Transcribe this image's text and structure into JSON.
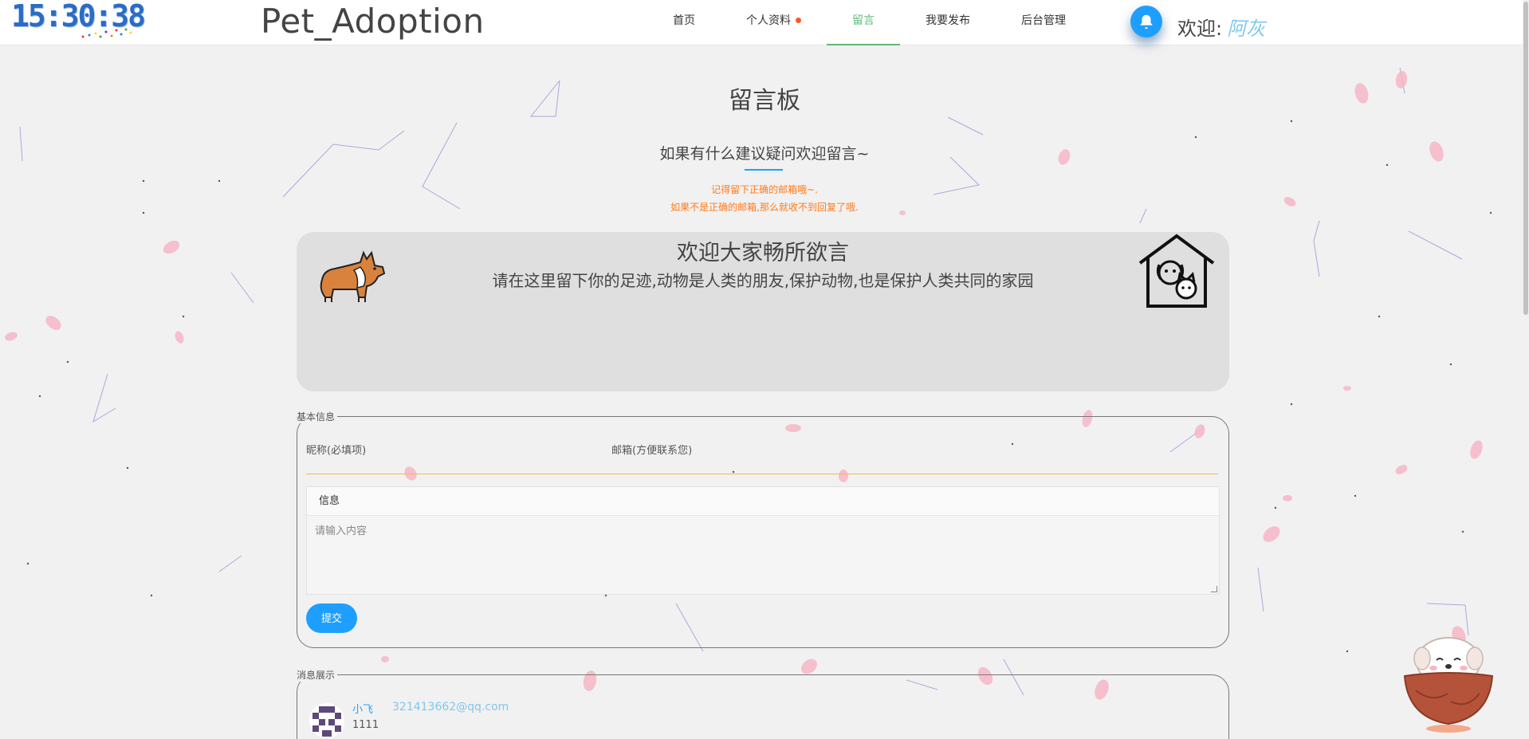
{
  "header": {
    "clock": "15:30:38",
    "site_title": "Pet_Adoption",
    "nav": [
      {
        "label": "首页"
      },
      {
        "label": "个人资料"
      },
      {
        "label": "留言"
      },
      {
        "label": "我要发布"
      },
      {
        "label": "后台管理"
      }
    ],
    "active_nav": "留言",
    "welcome_label": "欢迎:",
    "username": "阿灰",
    "bell_icon": "bell-icon"
  },
  "board": {
    "title": "留言板",
    "subtitle": "如果有什么建议疑问欢迎留言~",
    "tip1": "记得留下正确的邮箱哦~.",
    "tip2": "如果不是正确的邮箱,那么就收不到回复了哦."
  },
  "banner": {
    "title": "欢迎大家畅所欲言",
    "text": "请在这里留下你的足迹,动物是人类的朋友,保护动物,也是保护人类共同的家园"
  },
  "form": {
    "legend": "基本信息",
    "nickname_label": "昵称(必填项)",
    "email_label": "邮箱(方便联系您)",
    "message_label": "信息",
    "message_placeholder": "请输入内容",
    "submit_label": "提交"
  },
  "messages": {
    "legend": "消息展示",
    "items": [
      {
        "nickname": "小飞",
        "email": "321413662@qq.com",
        "content": "1111"
      }
    ]
  },
  "colors": {
    "accent_blue": "#1e9fff",
    "active_green": "#5fb878",
    "tip_orange": "#ff7a1a",
    "name_blue": "#7ec7f0"
  }
}
